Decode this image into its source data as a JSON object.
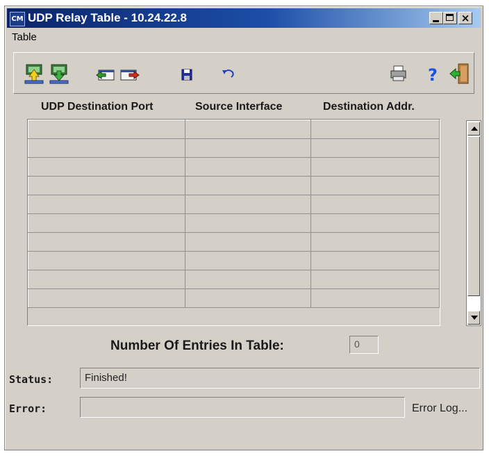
{
  "window": {
    "title": "UDP Relay Table - 10.24.22.8",
    "app_icon_text": "CM"
  },
  "menu": {
    "items": [
      {
        "label": "Table"
      }
    ]
  },
  "toolbar": {
    "buttons": [
      {
        "name": "upload-icon"
      },
      {
        "name": "download-icon"
      },
      {
        "name": "import-icon"
      },
      {
        "name": "export-icon"
      },
      {
        "name": "save-icon"
      },
      {
        "name": "undo-icon"
      },
      {
        "name": "print-icon"
      },
      {
        "name": "help-icon"
      },
      {
        "name": "exit-icon"
      }
    ]
  },
  "table": {
    "columns": [
      "UDP Destination Port",
      "Source Interface",
      "Destination Addr."
    ],
    "rows": []
  },
  "entries": {
    "label": "Number Of Entries In Table:",
    "value": "0"
  },
  "status": {
    "label": "Status:",
    "value": "Finished!"
  },
  "error": {
    "label": "Error:",
    "value": "",
    "log_label": "Error Log..."
  }
}
